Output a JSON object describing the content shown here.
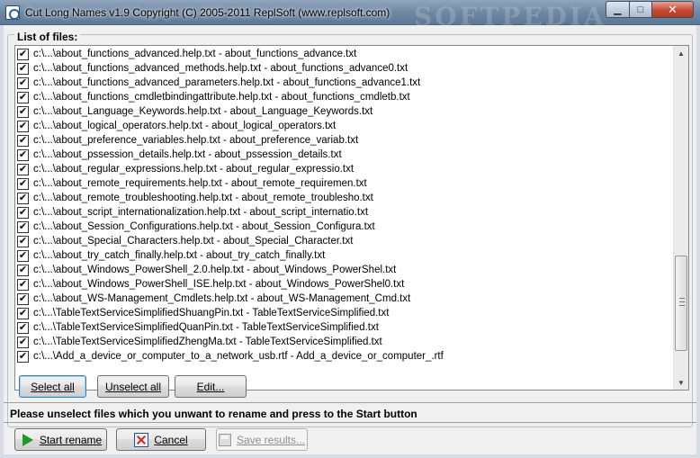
{
  "window": {
    "title": "Cut Long Names v1.9 Copyright (C) 2005-2011 ReplSoft (www.replsoft.com)",
    "watermark": "SOFTPEDIA",
    "controls": {
      "minimize": "▁",
      "maximize": "□",
      "close": "✕"
    }
  },
  "list": {
    "label": "List of files:",
    "check_glyph": "✔",
    "items": [
      "c:\\...\\about_functions_advanced.help.txt - about_functions_advance.txt",
      "c:\\...\\about_functions_advanced_methods.help.txt - about_functions_advance0.txt",
      "c:\\...\\about_functions_advanced_parameters.help.txt - about_functions_advance1.txt",
      "c:\\...\\about_functions_cmdletbindingattribute.help.txt - about_functions_cmdletb.txt",
      "c:\\...\\about_Language_Keywords.help.txt - about_Language_Keywords.txt",
      "c:\\...\\about_logical_operators.help.txt - about_logical_operators.txt",
      "c:\\...\\about_preference_variables.help.txt - about_preference_variab.txt",
      "c:\\...\\about_pssession_details.help.txt - about_pssession_details.txt",
      "c:\\...\\about_regular_expressions.help.txt - about_regular_expressio.txt",
      "c:\\...\\about_remote_requirements.help.txt - about_remote_requiremen.txt",
      "c:\\...\\about_remote_troubleshooting.help.txt - about_remote_troublesho.txt",
      "c:\\...\\about_script_internationalization.help.txt - about_script_internatio.txt",
      "c:\\...\\about_Session_Configurations.help.txt - about_Session_Configura.txt",
      "c:\\...\\about_Special_Characters.help.txt - about_Special_Character.txt",
      "c:\\...\\about_try_catch_finally.help.txt - about_try_catch_finally.txt",
      "c:\\...\\about_Windows_PowerShell_2.0.help.txt - about_Windows_PowerShel.txt",
      "c:\\...\\about_Windows_PowerShell_ISE.help.txt - about_Windows_PowerShel0.txt",
      "c:\\...\\about_WS-Management_Cmdlets.help.txt - about_WS-Management_Cmd.txt",
      "c:\\...\\TableTextServiceSimplifiedShuangPin.txt - TableTextServiceSimplified.txt",
      "c:\\...\\TableTextServiceSimplifiedQuanPin.txt - TableTextServiceSimplified.txt",
      "c:\\...\\TableTextServiceSimplifiedZhengMa.txt - TableTextServiceSimplified.txt",
      "c:\\...\\Add_a_device_or_computer_to_a_network_usb.rtf - Add_a_device_or_computer_.rtf"
    ],
    "scroll_up": "▲",
    "scroll_down": "▼"
  },
  "buttons": {
    "select_all": "Select all",
    "unselect_all": "Unselect all",
    "edit": "Edit...",
    "start_rename": "Start rename",
    "cancel": "Cancel",
    "save_results": "Save results..."
  },
  "hint": "Please unselect files which you unwant to rename and press to the Start button"
}
